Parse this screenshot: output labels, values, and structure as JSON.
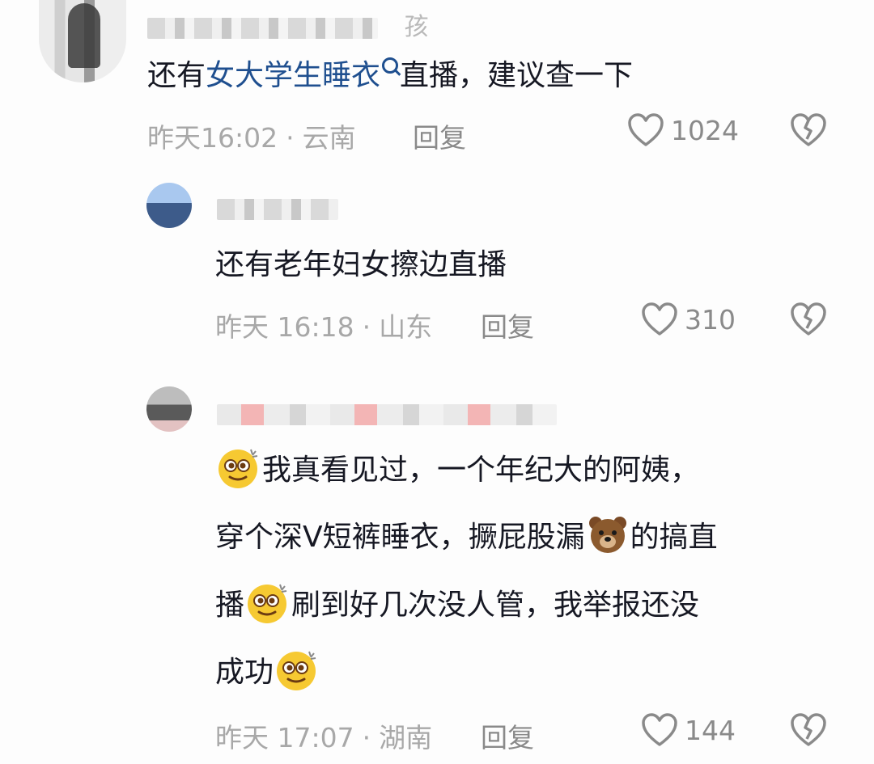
{
  "comments": [
    {
      "username_visible": "孩",
      "text_parts": [
        "还有",
        "女大学生睡衣",
        "直播，建议查一下"
      ],
      "time": "昨天16:02",
      "location": "云南",
      "reply_label": "回复",
      "likes": "1024",
      "like_icon": "heart-outline-icon",
      "dislike_icon": "broken-heart-icon"
    },
    {
      "text": "还有老年妇女擦边直播",
      "time": "昨天 16:18",
      "location": "山东",
      "reply_label": "回复",
      "likes": "310"
    },
    {
      "lines": [
        "我真看见过，一个年纪大的阿姨，",
        "穿个深V短裤睡衣，撅屁股漏",
        "的搞直",
        "播",
        "刷到好几次没人管，我举报还没",
        "成功"
      ],
      "emoji": "dizzy-face-emoji",
      "bear_emoji": "bear-face-emoji",
      "time": "昨天 17:07",
      "location": "湖南",
      "reply_label": "回复",
      "likes": "144"
    }
  ],
  "colors": {
    "link": "#1f4f8f",
    "meta": "#a8a8a8",
    "text": "#161823"
  }
}
